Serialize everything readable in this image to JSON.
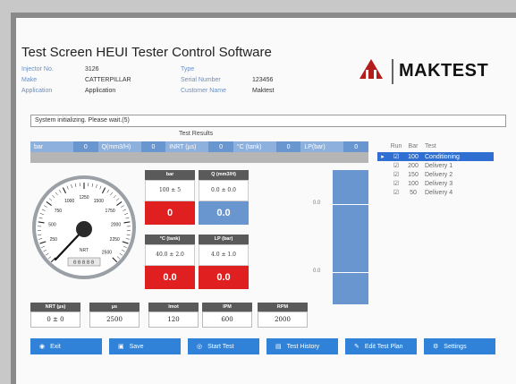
{
  "app": {
    "title": "Test Screen HEUI Tester Control Software",
    "brand": "MAKTEST"
  },
  "info": {
    "injector_no_label": "Injector No.",
    "injector_no": "3126",
    "make_label": "Make",
    "make": "CATTERPILLAR",
    "application_label": "Application",
    "application": "Application",
    "type_label": "Type",
    "type": "",
    "serial_label": "Serial Number",
    "serial": "123456",
    "customer_label": "Customer Name",
    "customer": "Maktest"
  },
  "status": "System initializing. Please wait.(5)",
  "results_title": "Test Results",
  "strip": [
    {
      "key": "bar",
      "value": "0"
    },
    {
      "key": "Q(mm3/H)",
      "value": "0"
    },
    {
      "key": "INRT (µs)",
      "value": "0"
    },
    {
      "key": "°C (tank)",
      "value": "0"
    },
    {
      "key": "LP(bar)",
      "value": "0"
    }
  ],
  "gauge": {
    "ticks": [
      "250",
      "500",
      "750",
      "1000",
      "1250",
      "1500",
      "1750",
      "2000",
      "2250",
      "2500"
    ],
    "label": "NRT",
    "odometer": "00000",
    "value": 0
  },
  "tiles": {
    "bar": {
      "header": "bar",
      "tol": "100 ± 5",
      "value": "0"
    },
    "q": {
      "header": "Q (mm3/H)",
      "tol": "0.0 ± 0.0",
      "value": "0.0"
    },
    "temp": {
      "header": "°C (tank)",
      "tol": "40.0 ± 2.0",
      "value": "0.0"
    },
    "lp": {
      "header": "LP (bar)",
      "tol": "4.0 ± 1.0",
      "value": "0.0"
    }
  },
  "vbar": {
    "mark_top": "0.0",
    "mark_mid": "0.0"
  },
  "runs": {
    "headers": [
      "Run",
      "Bar",
      "Test"
    ],
    "rows": [
      {
        "bar": "100",
        "test": "Conditioning",
        "selected": true
      },
      {
        "bar": "200",
        "test": "Delivery 1",
        "selected": false
      },
      {
        "bar": "150",
        "test": "Delivery 2",
        "selected": false
      },
      {
        "bar": "100",
        "test": "Delivery 3",
        "selected": false
      },
      {
        "bar": "50",
        "test": "Delivery 4",
        "selected": false
      }
    ]
  },
  "bottom": [
    {
      "header": "NRT (µs)",
      "value": "0 ± 0"
    },
    {
      "header": "µs",
      "value": "2500"
    },
    {
      "header": "Imot",
      "value": "120"
    },
    {
      "header": "IPM",
      "value": "600"
    },
    {
      "header": "RPM",
      "value": "2000"
    }
  ],
  "buttons": [
    {
      "label": "Exit",
      "icon": "exit-icon"
    },
    {
      "label": "Save",
      "icon": "save-icon"
    },
    {
      "label": "Start Test",
      "icon": "start-icon"
    },
    {
      "label": "Test History",
      "icon": "history-icon"
    },
    {
      "label": "Edit Test Plan",
      "icon": "edit-icon"
    },
    {
      "label": "Settings",
      "icon": "settings-icon"
    }
  ],
  "colors": {
    "accent": "#2f82d8",
    "alarm": "#e02020",
    "ok": "#6a96d0"
  }
}
